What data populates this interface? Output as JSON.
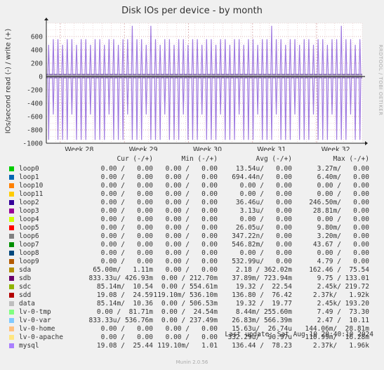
{
  "title": "Disk IOs per device - by month",
  "ylabel": "IOs/second read (-) / write (+)",
  "side_label": "RRDTOOL / TOBI OETIKER",
  "footer": "Munin 2.0.56",
  "last_update": "Last update: Sat Aug 10 20:40:10 2024",
  "columns": [
    "Cur (-/+)",
    "Min (-/+)",
    "Avg (-/+)",
    "Max (-/+)"
  ],
  "chart_data": {
    "type": "line",
    "title": "Disk IOs per device - by month",
    "ylabel": "IOs/second read (-) / write (+)",
    "ylim": [
      -1000,
      800
    ],
    "yticks": [
      -1000,
      -800,
      -600,
      -400,
      -200,
      0,
      200,
      400,
      600
    ],
    "ytick_labels": [
      "-1000",
      "-800",
      "-600",
      "-400",
      "-200",
      "0",
      "200",
      "400",
      "600"
    ],
    "xticks": [
      "Week 28",
      "Week 29",
      "Week 30",
      "Week 31",
      "Week 32"
    ],
    "grid": true,
    "pattern": {
      "days_shown": 34,
      "spikes_per_day": 2,
      "typical_write_peak": 560,
      "typical_read_peak": -950,
      "max_write_peak": 760,
      "write_baseline": 30,
      "read_baseline": -20,
      "color": "#a07be0"
    }
  },
  "legend": [
    {
      "name": "loop0",
      "color": "#00cc00",
      "cur": "0.00 /   0.00",
      "min": "0.00 /   0.00",
      "avg": "13.54u/   0.00",
      "max": "3.27m/   0.00"
    },
    {
      "name": "loop1",
      "color": "#0066b3",
      "cur": "0.00 /   0.00",
      "min": "0.00 /   0.00",
      "avg": "694.44n/   0.00",
      "max": "6.40m/   0.00"
    },
    {
      "name": "loop10",
      "color": "#ff8000",
      "cur": "0.00 /   0.00",
      "min": "0.00 /   0.00",
      "avg": "0.00 /   0.00",
      "max": "0.00 /   0.00"
    },
    {
      "name": "loop11",
      "color": "#ffcc00",
      "cur": "0.00 /   0.00",
      "min": "0.00 /   0.00",
      "avg": "0.00 /   0.00",
      "max": "0.00 /   0.00"
    },
    {
      "name": "loop2",
      "color": "#330099",
      "cur": "0.00 /   0.00",
      "min": "0.00 /   0.00",
      "avg": "36.46u/   0.00",
      "max": "246.50m/   0.00"
    },
    {
      "name": "loop3",
      "color": "#990099",
      "cur": "0.00 /   0.00",
      "min": "0.00 /   0.00",
      "avg": "3.13u/   0.00",
      "max": "28.81m/   0.00"
    },
    {
      "name": "loop4",
      "color": "#ccff00",
      "cur": "0.00 /   0.00",
      "min": "0.00 /   0.00",
      "avg": "0.00 /   0.00",
      "max": "0.00 /   0.00"
    },
    {
      "name": "loop5",
      "color": "#ff0000",
      "cur": "0.00 /   0.00",
      "min": "0.00 /   0.00",
      "avg": "26.05u/   0.00",
      "max": "9.80m/   0.00"
    },
    {
      "name": "loop6",
      "color": "#808080",
      "cur": "0.00 /   0.00",
      "min": "0.00 /   0.00",
      "avg": "347.22n/   0.00",
      "max": "3.20m/   0.00"
    },
    {
      "name": "loop7",
      "color": "#008f00",
      "cur": "0.00 /   0.00",
      "min": "0.00 /   0.00",
      "avg": "546.82m/   0.00",
      "max": "43.67 /   0.00"
    },
    {
      "name": "loop8",
      "color": "#00487d",
      "cur": "0.00 /   0.00",
      "min": "0.00 /   0.00",
      "avg": "0.00 /   0.00",
      "max": "0.00 /   0.00"
    },
    {
      "name": "loop9",
      "color": "#b35a00",
      "cur": "0.00 /   0.00",
      "min": "0.00 /   0.00",
      "avg": "532.99u/   0.00",
      "max": "4.79 /   0.00"
    },
    {
      "name": "sda",
      "color": "#b38f00",
      "cur": "65.00m/   1.11m",
      "min": "0.00 /   0.00",
      "avg": "2.18 / 362.02m",
      "max": "162.46 /  75.54"
    },
    {
      "name": "sdb",
      "color": "#6b006b",
      "cur": "833.33u/ 426.93m",
      "min": "0.00 / 212.70m",
      "avg": "37.89m/ 723.94m",
      "max": "9.75 / 133.01"
    },
    {
      "name": "sdc",
      "color": "#8fb300",
      "cur": "85.14m/  10.54",
      "min": "0.00 / 554.61m",
      "avg": "19.32 /  22.54",
      "max": "2.45k/ 219.72"
    },
    {
      "name": "sdd",
      "color": "#b30000",
      "cur": "19.08 /  24.59",
      "min": "119.10m/ 536.10m",
      "avg": "136.80 /  76.42",
      "max": "2.37k/   1.92k"
    },
    {
      "name": "data",
      "color": "#bebebe",
      "cur": "85.14m/  10.36",
      "min": "0.00 / 506.53m",
      "avg": "19.32 /  19.77",
      "max": "2.45k/ 193.20"
    },
    {
      "name": "lv-0-tmp",
      "color": "#80ff80",
      "cur": "0.00 /  81.71m",
      "min": "0.00 /  24.54m",
      "avg": "8.44m/ 255.60m",
      "max": "7.49 /  73.30"
    },
    {
      "name": "lv-0-var",
      "color": "#80c9ff",
      "cur": "833.33u/ 536.76m",
      "min": "0.00 / 237.49m",
      "avg": "26.83m/ 566.39m",
      "max": "2.47 /  10.11"
    },
    {
      "name": "lv-0-home",
      "color": "#ffc080",
      "cur": "0.00 /   0.00",
      "min": "0.00 /   0.00",
      "avg": "15.63u/  26.74u",
      "max": "144.06m/  28.81m"
    },
    {
      "name": "lv-0-apache",
      "color": "#ffe680",
      "cur": "0.00 /   0.00",
      "min": "0.00 /   0.00",
      "avg": "332.29u/  90.97u",
      "max": "110.99m/  16.28m"
    },
    {
      "name": "mysql",
      "color": "#aa80ff",
      "cur": "19.08 /  25.44",
      "min": "119.10m/   1.01",
      "avg": "136.44 /  78.23",
      "max": "2.37k/   1.96k"
    }
  ]
}
